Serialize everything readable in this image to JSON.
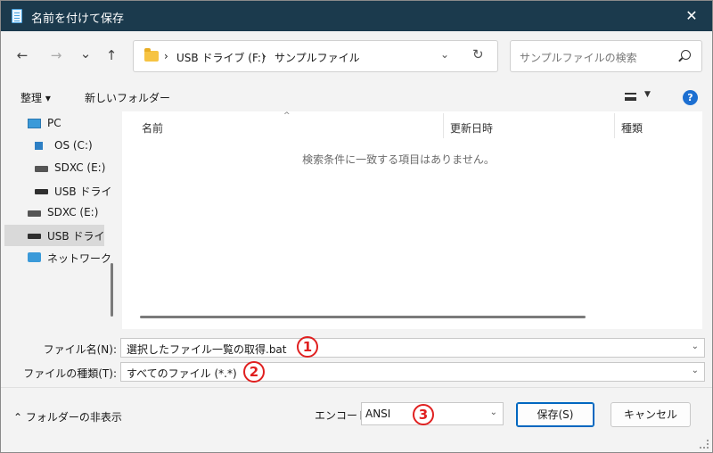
{
  "window": {
    "title": "名前を付けて保存",
    "close_symbol": "✕"
  },
  "nav": {
    "back": "←",
    "forward": "→",
    "recent": "⌄",
    "up": "↑"
  },
  "address": {
    "crumbs": [
      "USB ドライブ (F:)",
      "サンプルファイル"
    ],
    "separator": "›",
    "dropdown": "⌄",
    "refresh": "↻"
  },
  "search": {
    "placeholder": "サンプルファイルの検索"
  },
  "toolbar": {
    "organize": "整理 ▾",
    "new_folder": "新しいフォルダー",
    "view_drop": "▼",
    "help": "?"
  },
  "sidebar": {
    "items": [
      {
        "label": "PC",
        "icon": "pc-icon"
      },
      {
        "label": "OS (C:)",
        "icon": "os-drive-icon"
      },
      {
        "label": "SDXC (E:)",
        "icon": "drive-icon"
      },
      {
        "label": "USB ドライブ",
        "icon": "usb-drive-icon"
      },
      {
        "label": "SDXC (E:)",
        "icon": "drive-icon"
      },
      {
        "label": "USB ドライブ",
        "icon": "usb-drive-icon"
      },
      {
        "label": "ネットワーク",
        "icon": "network-icon"
      }
    ]
  },
  "content": {
    "columns": [
      "名前",
      "更新日時",
      "種類"
    ],
    "sort_caret": "^",
    "empty_message": "検索条件に一致する項目はありません。"
  },
  "form": {
    "filename_label": "ファイル名(N):",
    "filename_value": "選択したファイル一覧の取得.bat",
    "filetype_label": "ファイルの種類(T):",
    "filetype_value": "すべてのファイル (*.*)",
    "dropdown": "⌄"
  },
  "footer": {
    "hide_folders": "⌃ フォルダーの非表示",
    "encoding_label": "エンコード:",
    "encoding_value": "ANSI",
    "encoding_dropdown": "⌄",
    "save_button": "保存(S)",
    "cancel_button": "キャンセル"
  },
  "annotations": {
    "badge1": "1",
    "badge2": "2",
    "badge3": "3",
    "color": "#e02020"
  }
}
